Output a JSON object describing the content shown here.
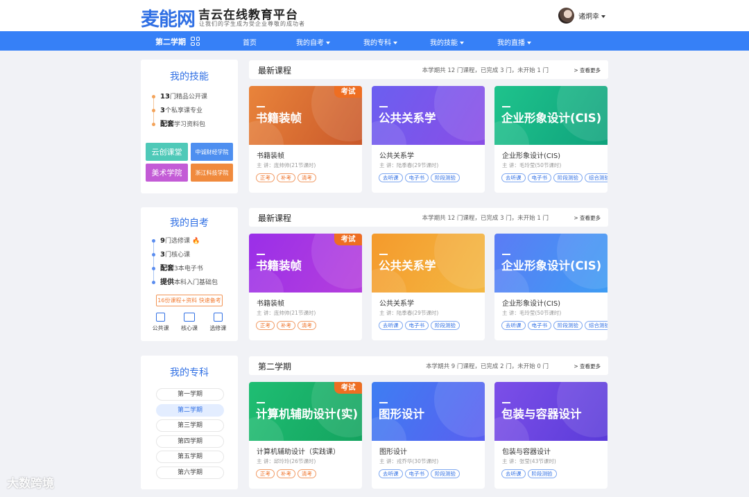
{
  "header": {
    "logo": "麦能网",
    "site_title": "吉云在线教育平台",
    "slogan": "让我们的学生成为受企业尊敬的成功者",
    "username": "诸炯幸"
  },
  "nav": {
    "term": "第二学期",
    "items": [
      {
        "label": "首页"
      },
      {
        "label": "我的自考"
      },
      {
        "label": "我的专科"
      },
      {
        "label": "我的技能"
      },
      {
        "label": "我的直播"
      }
    ]
  },
  "sidebar": {
    "skills": {
      "title": "我的技能",
      "items": [
        {
          "bold": "13",
          "text": "门精品公开课"
        },
        {
          "bold": "3",
          "text": "个私享课专业"
        },
        {
          "bold": "配套",
          "text": "学习资料包"
        }
      ],
      "brands": [
        "云创课堂",
        "中诚财经学院",
        "美术学院",
        "浙江科技学院"
      ]
    },
    "selfstudy": {
      "title": "我的自考",
      "items": [
        {
          "bold": "9",
          "text": "门选修课"
        },
        {
          "bold": "3",
          "text": "门核心课"
        },
        {
          "bold": "配套",
          "text": "3本电子书"
        },
        {
          "bold": "提供",
          "text": "本科入门基础包"
        }
      ],
      "promo": "16份课程+资料 快速备考",
      "categories": [
        "公共课",
        "核心课",
        "选修课"
      ]
    },
    "college": {
      "title": "我的专科",
      "terms": [
        "第一学期",
        "第二学期",
        "第三学期",
        "第四学期",
        "第五学期",
        "第六学期"
      ],
      "active_term": "第二学期"
    }
  },
  "sections": [
    {
      "title": "最新课程",
      "stats": "本学期共 12 门课程，已完成 3 门，未开始 1 门",
      "more": "> 查看更多",
      "courses": [
        {
          "cover_title": "书籍装帧",
          "exam": "考试",
          "name": "书籍装帧",
          "teacher": "主 讲：庞帅帅(21节课时)",
          "tag_style": "orange",
          "tags": [
            "正考",
            "补考",
            "清考"
          ],
          "gradient": [
            "#e9843b",
            "#c9582a"
          ]
        },
        {
          "cover_title": "公共关系学",
          "exam": "",
          "name": "公共关系学",
          "teacher": "主 讲：陆季春(29节课时)",
          "tag_style": "blue",
          "tags": [
            "去听课",
            "电子书",
            "阶段测验"
          ],
          "gradient": [
            "#6b5ff0",
            "#8a4de6"
          ]
        },
        {
          "cover_title": "企业形象设计(CIS)",
          "exam": "",
          "name": "企业形象设计(CIS)",
          "teacher": "主 讲：毛玲莹(50节课时)",
          "tag_style": "blue",
          "tags": [
            "去听课",
            "电子书",
            "阶段测验",
            "综合测验"
          ],
          "gradient": [
            "#1fc38c",
            "#0fa27c"
          ]
        }
      ]
    },
    {
      "title": "最新课程",
      "stats": "本学期共 12 门课程，已完成 3 门，未开始 1 门",
      "more": "> 查看更多",
      "courses": [
        {
          "cover_title": "书籍装帧",
          "exam": "考试",
          "name": "书籍装帧",
          "teacher": "主 讲：庞帅帅(21节课时)",
          "tag_style": "orange",
          "tags": [
            "正考",
            "补考",
            "清考"
          ],
          "gradient": [
            "#9a2fe8",
            "#b53fdc"
          ]
        },
        {
          "cover_title": "公共关系学",
          "exam": "",
          "name": "公共关系学",
          "teacher": "主 讲：陆季春(29节课时)",
          "tag_style": "blue",
          "tags": [
            "去听课",
            "电子书",
            "阶段测验"
          ],
          "gradient": [
            "#f49a2c",
            "#f3b843"
          ]
        },
        {
          "cover_title": "企业形象设计(CIS)",
          "exam": "",
          "name": "企业形象设计(CIS)",
          "teacher": "主 讲：毛玲莹(50节课时)",
          "tag_style": "blue",
          "tags": [
            "去听课",
            "电子书",
            "阶段测验",
            "综合测验"
          ],
          "gradient": [
            "#5b7cf5",
            "#3e9cf3"
          ]
        }
      ]
    },
    {
      "title": "第二学期",
      "stats": "本学期共 9 门课程，已完成 2 门，未开始 0 门",
      "more": "> 查看更多",
      "courses": [
        {
          "cover_title": "计算机辅助设计(实)",
          "exam": "考试",
          "name": "计算机辅助设计（实践课）",
          "teacher": "主 讲：邱玲玲(26节课时)",
          "tag_style": "orange",
          "tags": [
            "正考",
            "补考",
            "清考"
          ],
          "gradient": [
            "#1fbe73",
            "#14a35f"
          ]
        },
        {
          "cover_title": "图形设计",
          "exam": "",
          "name": "图形设计",
          "teacher": "主 讲：戎乔华(30节课时)",
          "tag_style": "blue",
          "tags": [
            "去听课",
            "电子书",
            "阶段测验"
          ],
          "gradient": [
            "#3e7ef2",
            "#5a5ff0"
          ]
        },
        {
          "cover_title": "包装与容器设计",
          "exam": "",
          "name": "包装与容器设计",
          "teacher": "主 讲：张莹(43节课时)",
          "tag_style": "blue",
          "tags": [
            "去听课",
            "阶段测验"
          ],
          "gradient": [
            "#7c4fe8",
            "#5a3bd9"
          ]
        }
      ]
    }
  ],
  "watermark": "大数跨境"
}
